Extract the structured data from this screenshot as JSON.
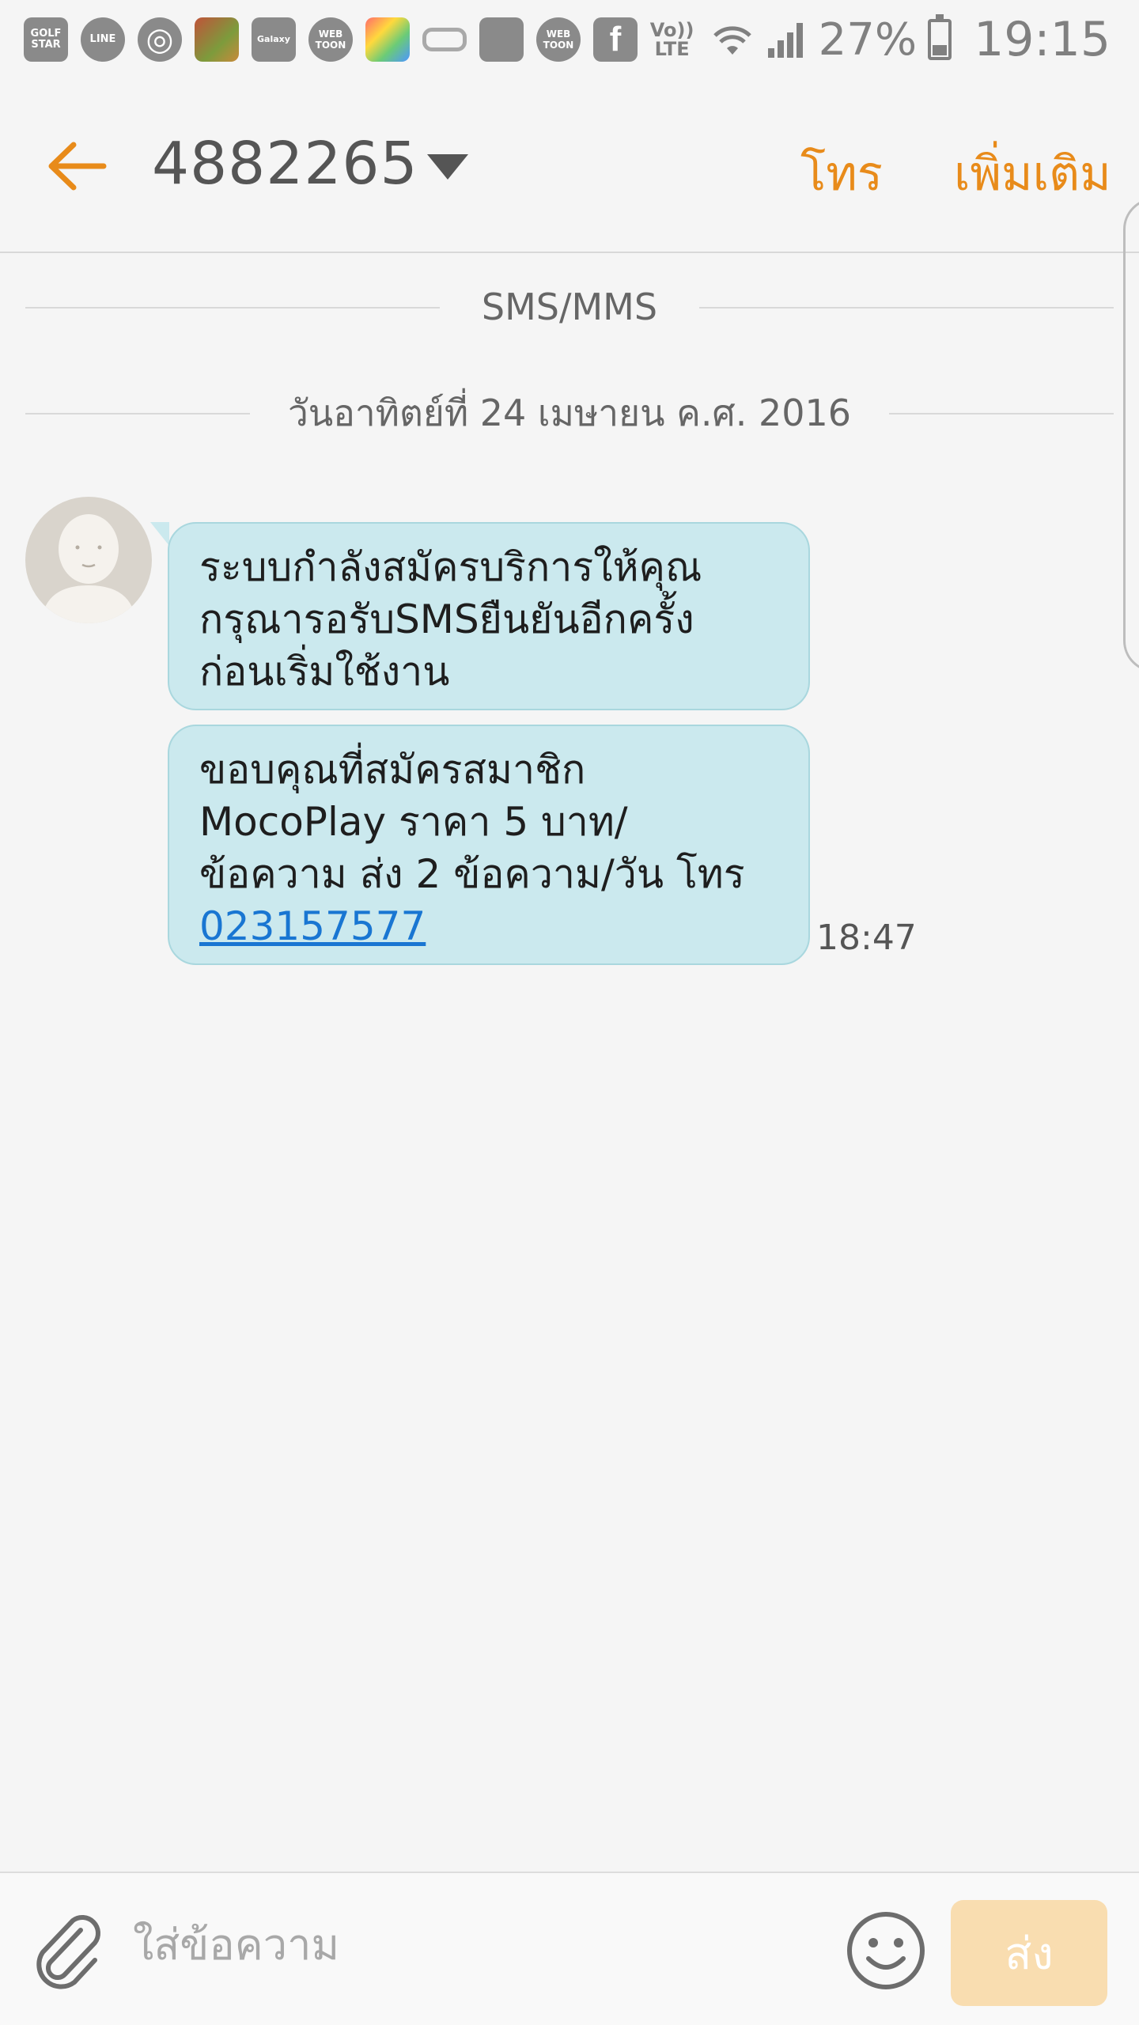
{
  "status_bar": {
    "notifications": [
      {
        "icon": "golf-star-icon",
        "label": "GOLF STAR"
      },
      {
        "icon": "line-icon",
        "label": "LINE"
      },
      {
        "icon": "sync-icon",
        "label": "◎"
      },
      {
        "icon": "game-icon",
        "label": ""
      },
      {
        "icon": "galaxy-store-icon",
        "label": "Galaxy"
      },
      {
        "icon": "webtoon-icon",
        "label": "WEB TOON"
      },
      {
        "icon": "camera-app-icon",
        "label": ""
      },
      {
        "icon": "vr-icon",
        "label": ""
      },
      {
        "icon": "messenger-icon",
        "label": ""
      },
      {
        "icon": "webtoon-icon-2",
        "label": "WEB TOON"
      },
      {
        "icon": "facebook-icon",
        "label": "f"
      }
    ],
    "network": "Vo)) LTE",
    "battery_percent": "27%",
    "time": "19:15"
  },
  "header": {
    "title": "4882265",
    "call_label": "โทร",
    "more_label": "เพิ่มเติม"
  },
  "conversation": {
    "channel_label": "SMS/MMS",
    "date_label": "วันอาทิตย์ที่ 24 เมษายน ค.ศ. 2016",
    "messages": [
      {
        "line1": "ระบบกำลังสมัครบริการให้คุณ",
        "line2": "กรุณารอรับSMSยืนยันอีกครั้ง",
        "line3": "ก่อนเริ่มใช้งาน"
      },
      {
        "line1": "ขอบคุณที่สมัครสมาชิก",
        "line2": "MocoPlay ราคา 5 บาท/",
        "line3": "ข้อความ ส่ง 2 ข้อความ/วัน โทร",
        "link": "023157577",
        "time": "18:47"
      }
    ]
  },
  "compose": {
    "placeholder": "ใส่ข้อความ",
    "send_label": "ส่ง"
  },
  "colors": {
    "accent": "#e88b1a",
    "bubble": "#cbe9ee",
    "link": "#1976d2",
    "send_disabled": "#f9ddb0"
  }
}
